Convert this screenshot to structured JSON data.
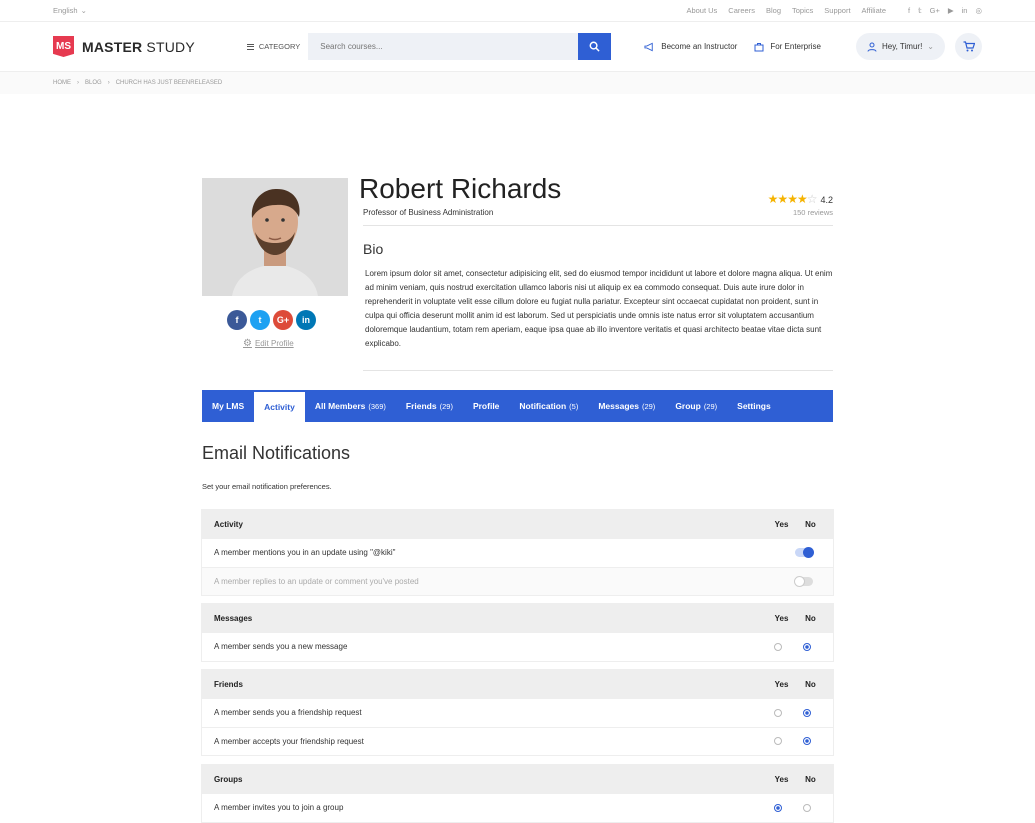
{
  "topbar": {
    "language": "English",
    "links": [
      "About Us",
      "Careers",
      "Blog",
      "Topics",
      "Support",
      "Affiliate"
    ],
    "social_icons": [
      "facebook-icon",
      "twitter-icon",
      "googleplus-icon",
      "youtube-icon",
      "linkedin-icon",
      "instagram-icon"
    ]
  },
  "header": {
    "logo_mark": "MS",
    "logo_bold": "MASTER",
    "logo_light": "STUDY",
    "category_label": "CATEGORY",
    "search_placeholder": "Search courses...",
    "instructor_label": "Become an Instructor",
    "enterprise_label": "For Enterprise",
    "user_label": "Hey, Timur!",
    "accent_color": "#2f5fd4",
    "brand_color": "#e63a50"
  },
  "breadcrumb": [
    "HOME",
    "BLOG",
    "CHURCH HAS JUST BEENRELEASED"
  ],
  "profile": {
    "name": "Robert Richards",
    "role": "Professor of Business Administration",
    "rating": "4.2",
    "stars_filled": 4,
    "stars_total": 5,
    "reviews": "150 reviews",
    "bio_title": "Bio",
    "bio": "Lorem ipsum dolor sit amet, consectetur adipisicing elit, sed do eiusmod tempor incididunt ut labore et dolore magna aliqua. Ut enim ad minim veniam, quis nostrud exercitation ullamco laboris nisi ut aliquip ex ea commodo consequat. Duis aute irure dolor in reprehenderit in voluptate velit esse cillum dolore eu fugiat nulla pariatur. Excepteur sint occaecat cupidatat non proident, sunt in culpa qui officia deserunt mollit anim id est laborum. Sed ut perspiciatis unde omnis iste natus error sit voluptatem accusantium doloremque laudantium, totam rem aperiam, eaque ipsa quae ab illo inventore veritatis et quasi architecto beatae vitae dicta sunt explicabo.",
    "edit_label": "Edit Profile",
    "socials": [
      {
        "icon": "f",
        "color": "#3b5998"
      },
      {
        "icon": "t",
        "color": "#1da1f2"
      },
      {
        "icon": "G+",
        "color": "#dd4b39"
      },
      {
        "icon": "in",
        "color": "#0077b5"
      }
    ]
  },
  "tabs": [
    {
      "label": "My LMS",
      "count": ""
    },
    {
      "label": "Activity",
      "count": "",
      "active": true
    },
    {
      "label": "All Members",
      "count": "(369)"
    },
    {
      "label": "Friends",
      "count": "(29)"
    },
    {
      "label": "Profile",
      "count": ""
    },
    {
      "label": "Notification",
      "count": "(5)"
    },
    {
      "label": "Messages",
      "count": "(29)"
    },
    {
      "label": "Group",
      "count": "(29)"
    },
    {
      "label": "Settings",
      "count": ""
    }
  ],
  "email_notifications": {
    "title": "Email Notifications",
    "subtitle": "Set your email notification preferences.",
    "yes_label": "Yes",
    "no_label": "No",
    "sections": [
      {
        "title": "Activity",
        "control": "toggle",
        "rows": [
          {
            "label": "A member mentions you in an update using \"@kiki\"",
            "on": true
          },
          {
            "label": "A member replies to an update or comment you've posted",
            "on": false,
            "dim": true
          }
        ]
      },
      {
        "title": "Messages",
        "control": "radio",
        "rows": [
          {
            "label": "A member sends you a new message",
            "yes": false
          }
        ]
      },
      {
        "title": "Friends",
        "control": "radio",
        "rows": [
          {
            "label": "A member sends you a friendship request",
            "yes": false
          },
          {
            "label": "A member accepts your friendship request",
            "yes": false
          }
        ]
      },
      {
        "title": "Groups",
        "control": "radio",
        "rows": [
          {
            "label": "A member invites you to join a group",
            "yes": true
          }
        ]
      }
    ]
  }
}
